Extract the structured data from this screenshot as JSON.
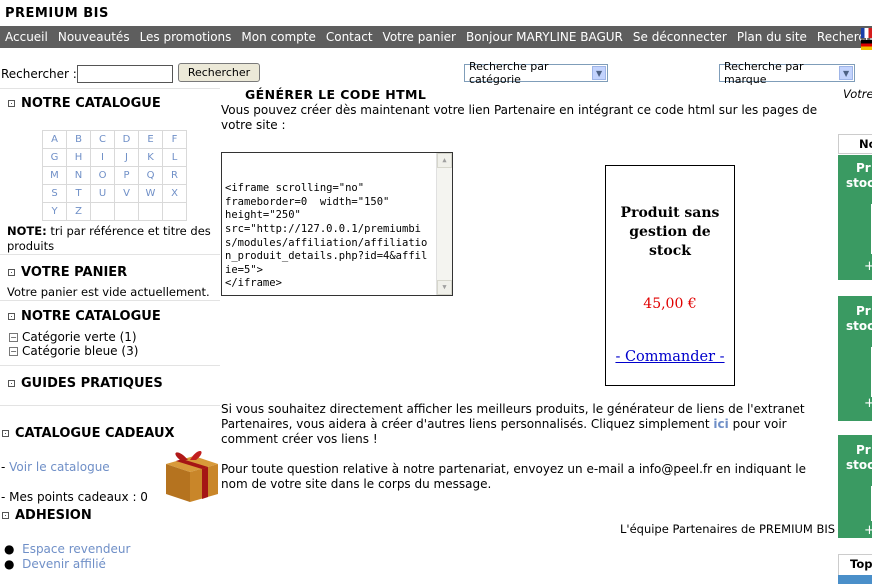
{
  "site": {
    "title": "PREMIUM BIS"
  },
  "nav": {
    "items": [
      "Accueil",
      "Nouveautés",
      "Les promotions",
      "Mon compte",
      "Contact",
      "Votre panier",
      "Bonjour MARYLINE BAGUR",
      "Se déconnecter",
      "Plan du site",
      "Rechercher"
    ]
  },
  "search": {
    "label": "Rechercher :",
    "value": "",
    "button": "Rechercher",
    "category_select": "Recherche par catégorie",
    "brand_select": "Recherche par marque"
  },
  "sidebar": {
    "catalog_title": "NOTRE CATALOGUE",
    "letters": [
      [
        "A",
        "B",
        "C",
        "D",
        "E",
        "F"
      ],
      [
        "G",
        "H",
        "I",
        "J",
        "K",
        "L"
      ],
      [
        "M",
        "N",
        "O",
        "P",
        "Q",
        "R"
      ],
      [
        "S",
        "T",
        "U",
        "V",
        "W",
        "X"
      ],
      [
        "Y",
        "Z",
        "",
        "",
        "",
        ""
      ]
    ],
    "note_label": "NOTE:",
    "note_text": " tri par référence et titre des produits",
    "cart_title": "VOTRE PANIER",
    "cart_text": "Votre panier est vide actuellement.",
    "catalog2_title": "NOTRE CATALOGUE",
    "categories": [
      "Catégorie verte (1)",
      "Catégorie bleue (3)"
    ],
    "guides_title": "GUIDES PRATIQUES",
    "gifts_title": "CATALOGUE CADEAUX",
    "gifts_link": "Voir le catalogue",
    "gifts_points": "- Mes points cadeaux : 0",
    "adhesion_title": "ADHESION",
    "adhesion_links": [
      "Espace revendeur",
      "Devenir affilié"
    ]
  },
  "main": {
    "title": "GÉNÉRER LE CODE HTML",
    "intro": "Vous pouvez créer dès maintenant votre lien Partenaire en intégrant ce code html sur les pages de votre site :",
    "code": "<iframe scrolling=\"no\"\nframeborder=0  width=\"150\"\nheight=\"250\"\nsrc=\"http://127.0.0.1/premiumbis/modules/affiliation/affiliation_produit_details.php?id=4&affilie=5\">\n</iframe>",
    "product_name": "Produit sans gestion de stock",
    "product_price": "45,00 €",
    "product_order": "- Commander -",
    "para2_before": "Si vous souhaitez directement afficher les meilleurs produits, le générateur de liens de l'extranet Partenaires, vous aidera à créer d'autres liens personnalisés. Cliquez simplement ",
    "para2_link": "ici",
    "para2_after": " pour voir comment créer vos liens !",
    "para3": "Pour toute question relative à notre partenariat, envoyez un e-mail a info@peel.fr en indiquant le nom de votre site dans le corps du message.",
    "signature": "L'équipe Partenaires de PREMIUM BIS"
  },
  "right": {
    "top_text": "Votre",
    "tab_label": "No",
    "cards": [
      {
        "line1": "Pr",
        "line2": "stoc",
        "plus": "+"
      },
      {
        "line1": "Pr",
        "line2": "stoc",
        "plus": "+"
      },
      {
        "line1": "Pr",
        "line2": "stoc",
        "plus": "+"
      }
    ],
    "bottom_label": "Top"
  }
}
